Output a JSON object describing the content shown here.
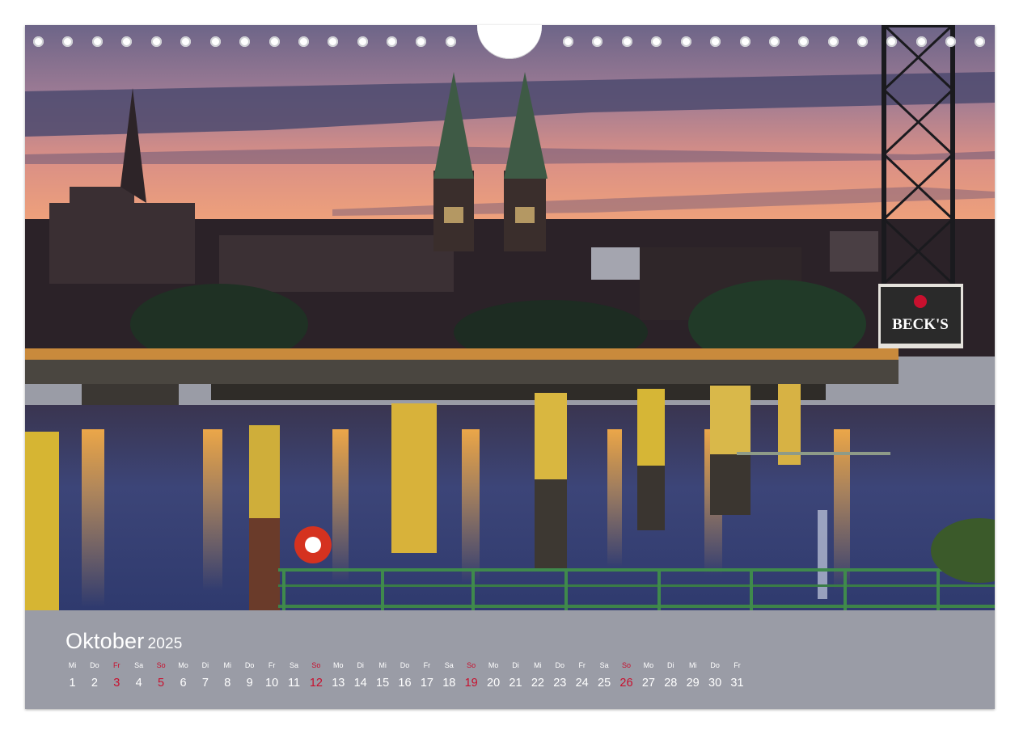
{
  "calendar": {
    "month": "Oktober",
    "year": "2025",
    "days": [
      {
        "wd": "Mi",
        "d": "1"
      },
      {
        "wd": "Do",
        "d": "2"
      },
      {
        "wd": "Fr",
        "d": "3",
        "holiday": true
      },
      {
        "wd": "Sa",
        "d": "4"
      },
      {
        "wd": "So",
        "d": "5",
        "holiday": true
      },
      {
        "wd": "Mo",
        "d": "6"
      },
      {
        "wd": "Di",
        "d": "7"
      },
      {
        "wd": "Mi",
        "d": "8"
      },
      {
        "wd": "Do",
        "d": "9"
      },
      {
        "wd": "Fr",
        "d": "10"
      },
      {
        "wd": "Sa",
        "d": "11"
      },
      {
        "wd": "So",
        "d": "12",
        "holiday": true
      },
      {
        "wd": "Mo",
        "d": "13"
      },
      {
        "wd": "Di",
        "d": "14"
      },
      {
        "wd": "Mi",
        "d": "15"
      },
      {
        "wd": "Do",
        "d": "16"
      },
      {
        "wd": "Fr",
        "d": "17"
      },
      {
        "wd": "Sa",
        "d": "18"
      },
      {
        "wd": "So",
        "d": "19",
        "holiday": true
      },
      {
        "wd": "Mo",
        "d": "20"
      },
      {
        "wd": "Di",
        "d": "21"
      },
      {
        "wd": "Mi",
        "d": "22"
      },
      {
        "wd": "Do",
        "d": "23"
      },
      {
        "wd": "Fr",
        "d": "24"
      },
      {
        "wd": "Sa",
        "d": "25"
      },
      {
        "wd": "So",
        "d": "26",
        "holiday": true
      },
      {
        "wd": "Mo",
        "d": "27"
      },
      {
        "wd": "Di",
        "d": "28"
      },
      {
        "wd": "Mi",
        "d": "29"
      },
      {
        "wd": "Do",
        "d": "30"
      },
      {
        "wd": "Fr",
        "d": "31"
      }
    ]
  },
  "photo": {
    "sign_text": "BECK'S"
  },
  "colors": {
    "calendar_band": "#9a9ca6",
    "holiday_red": "#c8102e",
    "text_white": "#ffffff"
  }
}
